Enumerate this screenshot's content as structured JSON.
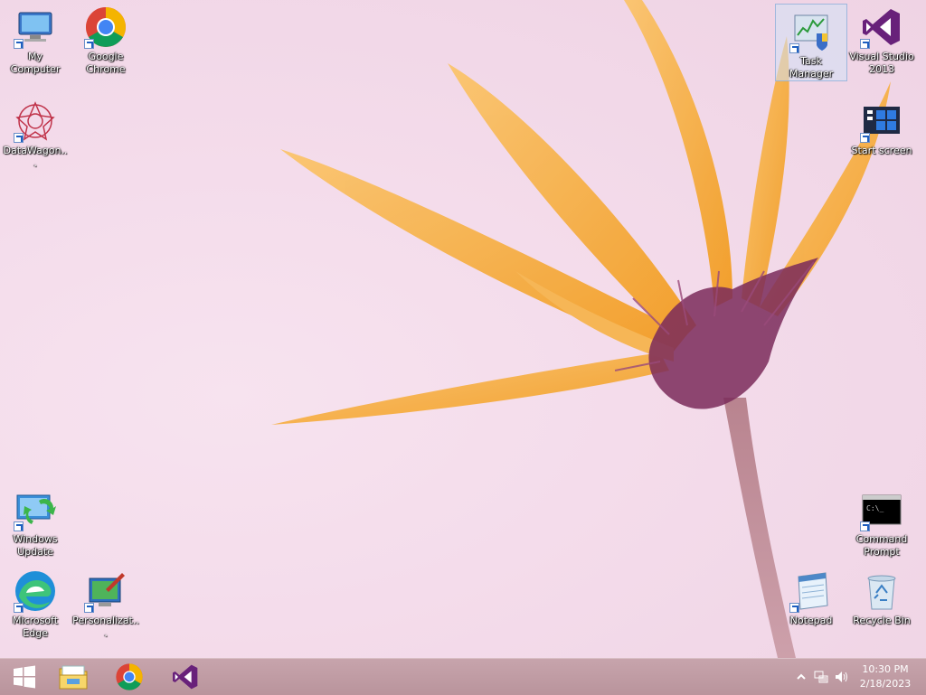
{
  "desktop": {
    "icons": [
      {
        "label": "My Computer"
      },
      {
        "label": "Google Chrome"
      },
      {
        "label": "DataWagon..."
      },
      {
        "label": "Task Manager"
      },
      {
        "label": "Visual Studio 2013"
      },
      {
        "label": "Start screen"
      },
      {
        "label": "Windows Update"
      },
      {
        "label": "Microsoft Edge"
      },
      {
        "label": "Personalizat..."
      },
      {
        "label": "Command Prompt"
      },
      {
        "label": "Notepad"
      },
      {
        "label": "Recycle Bin"
      }
    ],
    "selected_icon": "Task Manager"
  },
  "taskbar": {
    "pinned": [
      "start-icon",
      "file-explorer-icon",
      "chrome-icon",
      "visual-studio-icon"
    ],
    "tray_icons": [
      "show-hidden-icons-chevron",
      "network-icon",
      "volume-icon"
    ],
    "clock": {
      "time": "10:30 PM",
      "date": "2/18/2023"
    }
  },
  "colors": {
    "taskbar": "#bd98a0",
    "wallpaper_bg": "#f4dceb",
    "petal": "#f7a928",
    "flower_center": "#7a2a5a"
  }
}
